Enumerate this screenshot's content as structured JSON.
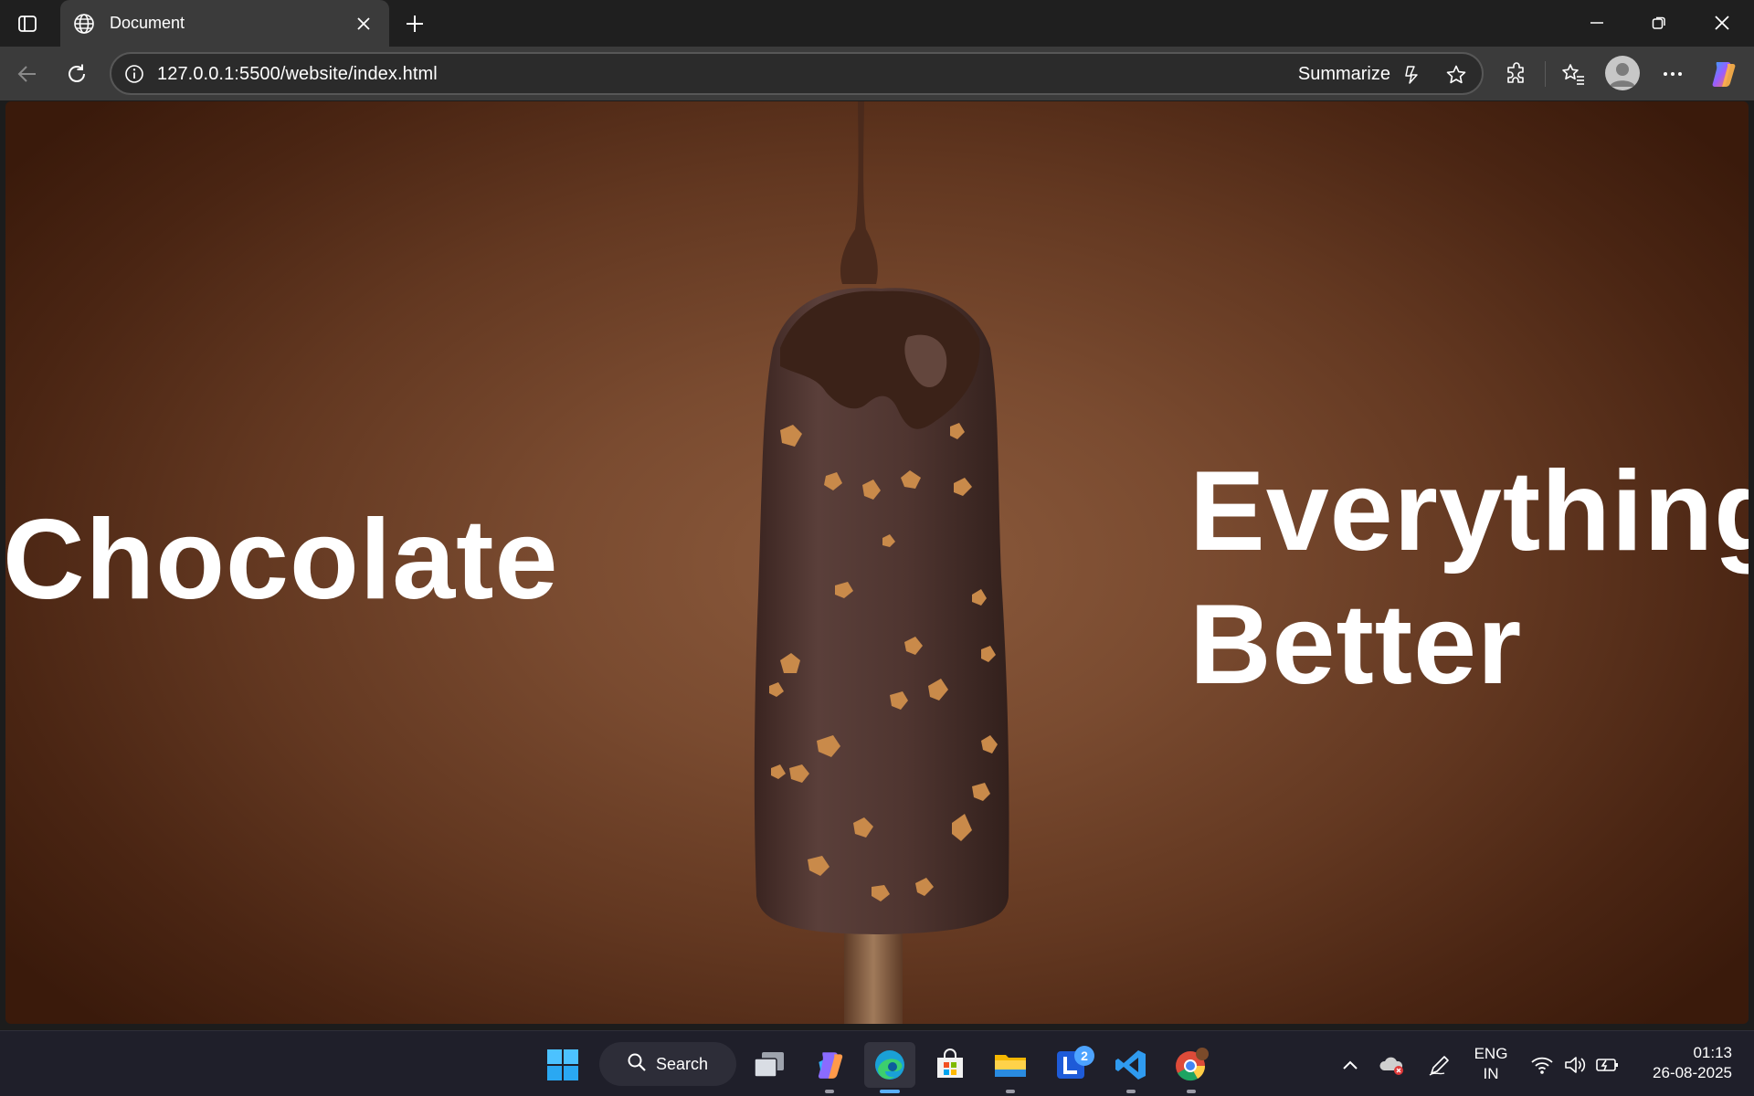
{
  "browser": {
    "tab": {
      "title": "Document"
    },
    "address": {
      "url": "127.0.0.1:5500/website/index.html",
      "summarize_label": "Summarize"
    }
  },
  "page": {
    "left_text": "Chocolate",
    "right_line1": "Everything",
    "right_line2": "Better"
  },
  "taskbar": {
    "search_label": "Search",
    "badge_count": "2",
    "lang_line1": "ENG",
    "lang_line2": "IN",
    "time": "01:13",
    "date": "26-08-2025"
  },
  "icons": [
    "tab-actions-icon",
    "globe-icon",
    "close-icon",
    "plus-icon",
    "minimize-icon",
    "restore-icon",
    "window-close-icon",
    "back-icon",
    "refresh-icon",
    "info-icon",
    "copilot-summarize-icon",
    "star-icon",
    "extensions-icon",
    "favorites-icon",
    "profile-icon",
    "more-icon",
    "copilot-icon",
    "windows-start-icon",
    "search-icon",
    "task-view-icon",
    "edge-icon",
    "store-icon",
    "file-explorer-icon",
    "vscode-icon",
    "chrome-icon",
    "chevron-up-icon",
    "onedrive-icon",
    "pen-icon",
    "wifi-icon",
    "volume-icon",
    "battery-icon"
  ],
  "colors": {
    "accent": "#5ab0ff",
    "page_bg": "#7a4b30"
  }
}
